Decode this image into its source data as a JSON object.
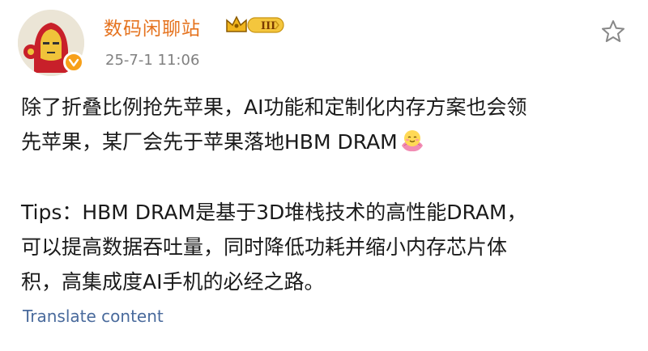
{
  "post": {
    "username": "数码闲聊站",
    "vip_level": "III",
    "timestamp": "25-7-1 11:06",
    "paragraph1": "除了折叠比例抢先苹果，AI功能和定制化内存方案也会领\n先苹果，某厂会先于苹果落地HBM DRAM",
    "emoji": "lotus-smile-emoji",
    "paragraph2": "Tips：HBM DRAM是基于3D堆栈技术的高性能DRAM，\n可以提高数据吞吐量，同时降低功耗并缩小内存芯片体\n积，高集成度AI手机的必经之路。",
    "translate_label": "Translate content"
  },
  "icons": {
    "favorite": "star-outline-icon",
    "verified": "verified-badge-icon",
    "vip": "crown-vip-badge-icon"
  },
  "colors": {
    "username": "#e5731f",
    "link": "#496a9c",
    "timestamp": "#808080",
    "text": "#1a1a1a"
  }
}
